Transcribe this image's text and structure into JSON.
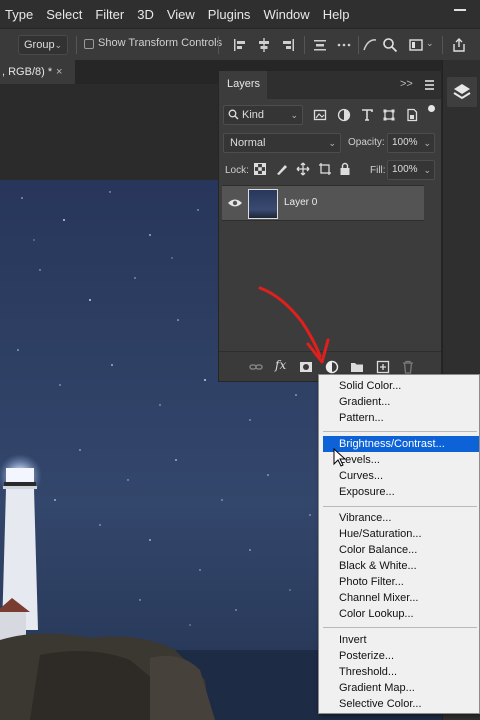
{
  "menubar": {
    "items": [
      "Type",
      "Select",
      "Filter",
      "3D",
      "View",
      "Plugins",
      "Window",
      "Help"
    ]
  },
  "options_bar": {
    "group_select": "Group",
    "show_transform_label": "Show Transform Controls",
    "icons": [
      "align-left-icon",
      "align-center-icon",
      "align-right-icon",
      "distribute-icon",
      "more-icon",
      "curves-icon",
      "search-icon",
      "workspace-icon",
      "share-icon"
    ]
  },
  "document_tab": {
    "label": ", RGB/8) *",
    "close": "×"
  },
  "layers_panel": {
    "title": "Layers",
    "more": ">>",
    "kind_filter": "Kind",
    "blend_mode": "Normal",
    "opacity_label": "Opacity:",
    "opacity_value": "100%",
    "lock_label": "Lock:",
    "fill_label": "Fill:",
    "fill_value": "100%",
    "layers": [
      {
        "name": "Layer 0",
        "visible": true
      }
    ]
  },
  "adjustment_menu": {
    "group1": [
      "Solid Color...",
      "Gradient...",
      "Pattern..."
    ],
    "group2": [
      "Brightness/Contrast...",
      "Levels...",
      "Curves...",
      "Exposure..."
    ],
    "group3": [
      "Vibrance...",
      "Hue/Saturation...",
      "Color Balance...",
      "Black & White...",
      "Photo Filter...",
      "Channel Mixer...",
      "Color Lookup..."
    ],
    "group4": [
      "Invert",
      "Posterize...",
      "Threshold...",
      "Gradient Map...",
      "Selective Color..."
    ],
    "highlighted": "Brightness/Contrast..."
  },
  "colors": {
    "highlight": "#0c62d6",
    "annotation": "#e0201c",
    "panel_bg": "#3c3c3c",
    "app_bg": "#2b2b2b"
  }
}
